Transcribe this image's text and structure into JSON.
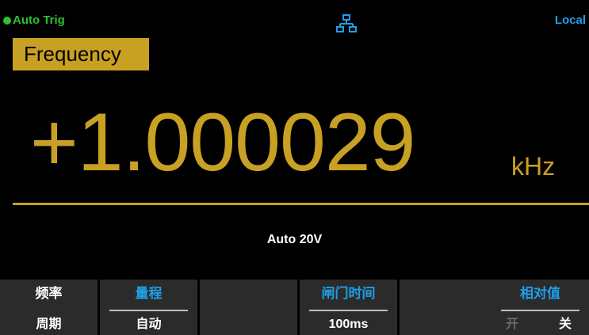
{
  "status": {
    "trigger": "Auto Trig",
    "network_icon": "network-icon",
    "mode": "Local"
  },
  "function": "Frequency",
  "measurement": {
    "value": "+1.000029",
    "unit": "kHz"
  },
  "range_info": "Auto 20V",
  "softkeys": [
    {
      "top": "频率",
      "bottom": "周期"
    },
    {
      "top": "量程",
      "bottom": "自动"
    },
    {
      "top": "",
      "bottom": ""
    },
    {
      "top": "闸门时间",
      "bottom": "100ms"
    },
    {
      "top": "",
      "bottom": ""
    },
    {
      "top": "相对值",
      "option_on": "开",
      "option_off": "关"
    }
  ],
  "colors": {
    "accent": "#c8a024",
    "trigger_green": "#2fbf2f",
    "info_blue": "#1e9fe8",
    "softkey_bg": "#2b2b2b"
  }
}
